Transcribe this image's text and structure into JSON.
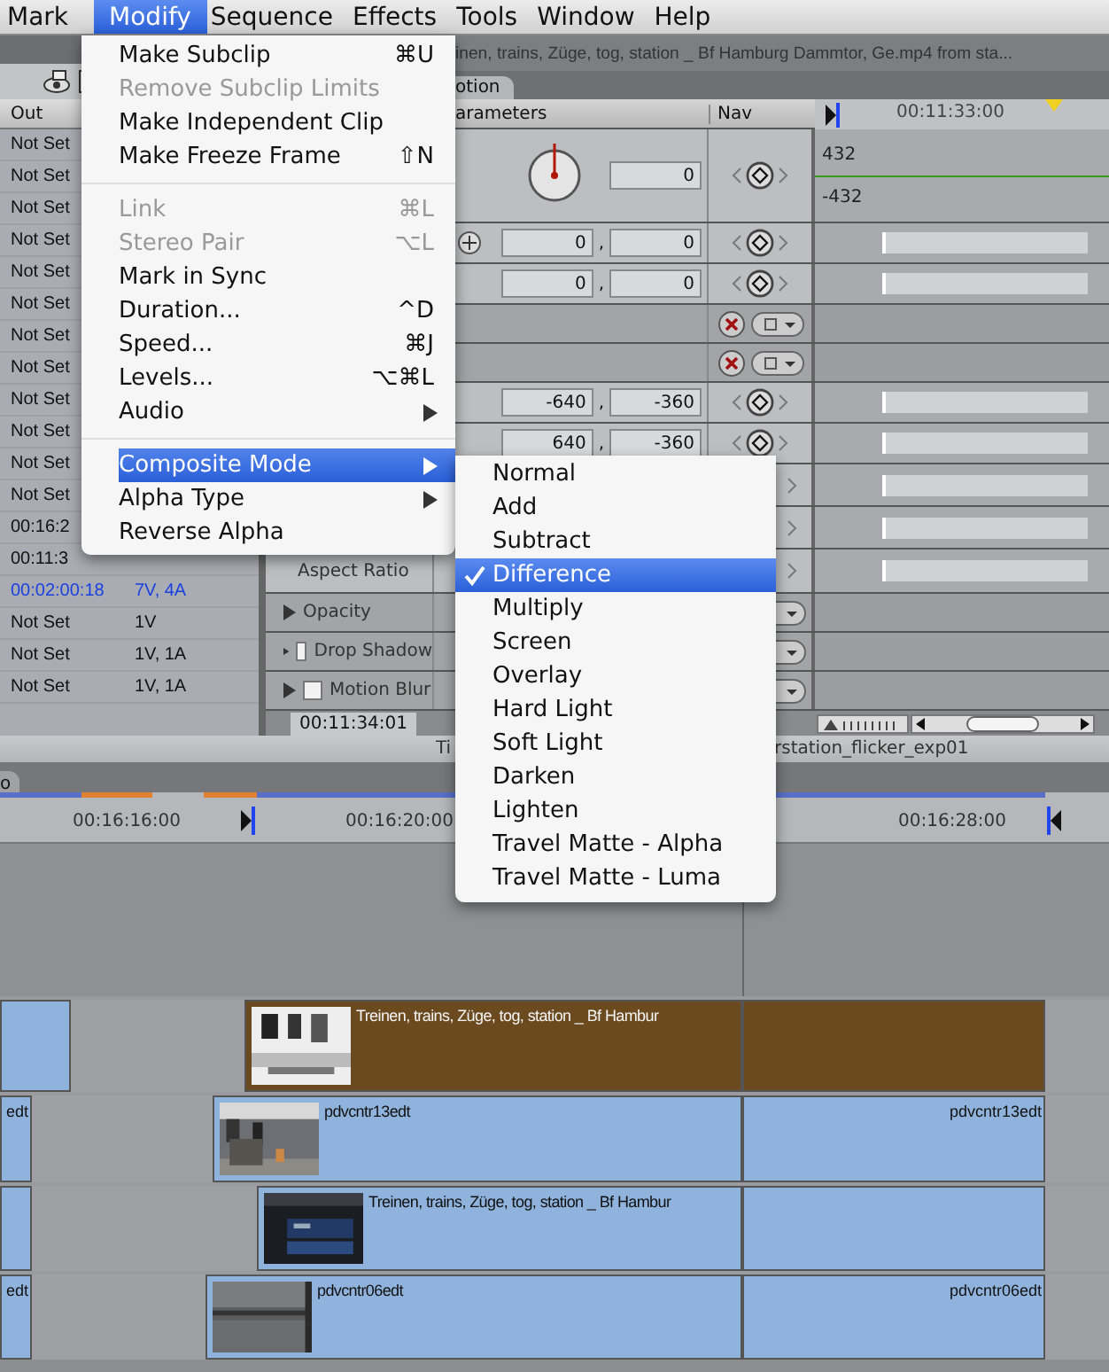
{
  "menu_bar": [
    {
      "label": "Mark",
      "selected": false
    },
    {
      "label": "Modify",
      "selected": true
    },
    {
      "label": "Sequence",
      "selected": false
    },
    {
      "label": "Effects",
      "selected": false
    },
    {
      "label": "Tools",
      "selected": false
    },
    {
      "label": "Window",
      "selected": false
    },
    {
      "label": "Help",
      "selected": false
    }
  ],
  "modify_menu": [
    {
      "label": "Make Subclip",
      "shortcut": "⌘U",
      "disabled": false,
      "selected": false,
      "submenu": false,
      "separator_before": false
    },
    {
      "label": "Remove Subclip Limits",
      "disabled": true,
      "selected": false,
      "submenu": false,
      "separator_before": false
    },
    {
      "label": "Make Independent Clip",
      "disabled": false,
      "selected": false,
      "submenu": false,
      "separator_before": false
    },
    {
      "label": "Make Freeze Frame",
      "shortcut": "⇧N",
      "disabled": false,
      "selected": false,
      "submenu": false,
      "separator_before": false
    },
    {
      "label": "Link",
      "shortcut": "⌘L",
      "disabled": true,
      "selected": false,
      "submenu": false,
      "separator_before": true
    },
    {
      "label": "Stereo Pair",
      "shortcut": "⌥L",
      "disabled": true,
      "selected": false,
      "submenu": false,
      "separator_before": false
    },
    {
      "label": "Mark in Sync",
      "disabled": false,
      "selected": false,
      "submenu": false,
      "separator_before": false
    },
    {
      "label": "Duration...",
      "shortcut": "^D",
      "disabled": false,
      "selected": false,
      "submenu": false,
      "separator_before": false
    },
    {
      "label": "Speed...",
      "shortcut": "⌘J",
      "disabled": false,
      "selected": false,
      "submenu": false,
      "separator_before": false
    },
    {
      "label": "Levels...",
      "shortcut": "⌥⌘L",
      "disabled": false,
      "selected": false,
      "submenu": false,
      "separator_before": false
    },
    {
      "label": "Audio",
      "disabled": false,
      "selected": false,
      "submenu": true,
      "separator_before": false
    },
    {
      "label": "Composite Mode",
      "disabled": false,
      "selected": true,
      "submenu": true,
      "separator_before": true
    },
    {
      "label": "Alpha Type",
      "disabled": false,
      "selected": false,
      "submenu": true,
      "separator_before": false
    },
    {
      "label": "Reverse Alpha",
      "disabled": false,
      "selected": false,
      "submenu": false,
      "separator_before": false
    }
  ],
  "composite_submenu": [
    {
      "label": "Normal",
      "checked": false,
      "selected": false
    },
    {
      "label": "Add",
      "checked": false,
      "selected": false
    },
    {
      "label": "Subtract",
      "checked": false,
      "selected": false
    },
    {
      "label": "Difference",
      "checked": true,
      "selected": true
    },
    {
      "label": "Multiply",
      "checked": false,
      "selected": false
    },
    {
      "label": "Screen",
      "checked": false,
      "selected": false
    },
    {
      "label": "Overlay",
      "checked": false,
      "selected": false
    },
    {
      "label": "Hard Light",
      "checked": false,
      "selected": false
    },
    {
      "label": "Soft Light",
      "checked": false,
      "selected": false
    },
    {
      "label": "Darken",
      "checked": false,
      "selected": false
    },
    {
      "label": "Lighten",
      "checked": false,
      "selected": false
    },
    {
      "label": "Travel Matte - Alpha",
      "checked": false,
      "selected": false
    },
    {
      "label": "Travel Matte - Luma",
      "checked": false,
      "selected": false
    }
  ],
  "browser": {
    "header": "Out",
    "rows": [
      {
        "out": "Not Set",
        "highlighted": false
      },
      {
        "out": "Not Set",
        "highlighted": false
      },
      {
        "out": "Not Set",
        "highlighted": false
      },
      {
        "out": "Not Set",
        "highlighted": false
      },
      {
        "out": "Not Set",
        "highlighted": false
      },
      {
        "out": "Not Set",
        "highlighted": false
      },
      {
        "out": "Not Set",
        "highlighted": false
      },
      {
        "out": "Not Set",
        "highlighted": false
      },
      {
        "out": "Not Set",
        "highlighted": false
      },
      {
        "out": "Not Set",
        "highlighted": false
      },
      {
        "out": "Not Set",
        "highlighted": false
      },
      {
        "out": "Not Set",
        "highlighted": false
      },
      {
        "out": "00:16:2",
        "highlighted": false
      },
      {
        "out": "00:11:3",
        "highlighted": false
      },
      {
        "out": "00:02:00:18",
        "tracks": "7V, 4A",
        "highlighted": true
      },
      {
        "out": "Not Set",
        "tracks": "1V",
        "highlighted": false
      },
      {
        "out": "Not Set",
        "tracks": "1V, 1A",
        "highlighted": false
      },
      {
        "out": "Not Set",
        "tracks": "1V, 1A",
        "highlighted": false
      }
    ]
  },
  "viewer": {
    "title": "inen, trains, Züge, tog, station _ Bf Hamburg Dammtor, Ge.mp4 from sta...",
    "tab": "otion",
    "headers": [
      "arameters",
      "Nav"
    ],
    "rows": [
      {
        "kind": "dial",
        "value": "0"
      },
      {
        "kind": "pair",
        "values": [
          "0",
          "0"
        ],
        "separator": ",",
        "crosshair": true
      },
      {
        "kind": "pair",
        "values": [
          "0",
          "0"
        ],
        "separator": ","
      },
      {
        "kind": "section"
      },
      {
        "kind": "section"
      },
      {
        "kind": "pair",
        "values": [
          "-640",
          "-360"
        ],
        "separator": ","
      },
      {
        "kind": "pair",
        "values": [
          "640",
          "-360"
        ],
        "separator": ","
      },
      {
        "kind": "nav_only"
      },
      {
        "kind": "nav_only"
      },
      {
        "kind": "param",
        "label": "Aspect Ratio"
      },
      {
        "kind": "group",
        "label": "Opacity"
      },
      {
        "kind": "group",
        "label": "Drop Shadow",
        "checked": false
      },
      {
        "kind": "group",
        "label": "Motion Blur",
        "checked": false
      }
    ],
    "timecode": "00:11:34:01"
  },
  "graph": {
    "timecode": "00:11:33:00",
    "values": [
      "432",
      "-432"
    ],
    "zoom_slider": {
      "level": 0.05
    }
  },
  "timeline": {
    "title_left": "Ti",
    "title_right": "rstation_flicker_exp01",
    "tab": "o",
    "ruler": [
      "00:16:16:00",
      "00:16:20:00",
      "00:16:28:00"
    ],
    "tracks": [
      {
        "clips": [
          {
            "color": "#8fb3dc",
            "thumbnail": false
          },
          {
            "color": "#6b4a1f",
            "thumbnail": true,
            "label": "Treinen, trains, Züge, tog, station _ Bf Hambur"
          },
          {
            "color": "#6b4a1f",
            "thumbnail": false
          }
        ]
      },
      {
        "clips": [
          {
            "color": "#8fb3dc",
            "thumbnail": false,
            "label": "edt"
          },
          {
            "color": "#8fb3dc",
            "thumbnail": true,
            "label": "pdvcntr13edt"
          },
          {
            "color": "#8fb3dc",
            "thumbnail": false,
            "label": "pdvcntr13edt"
          }
        ]
      },
      {
        "clips": [
          {
            "color": "#8fb3dc",
            "thumbnail": false
          },
          {
            "color": "#8fb3dc",
            "thumbnail": true,
            "label": "Treinen, trains, Züge, tog, station _ Bf Hambur"
          },
          {
            "color": "#8fb3dc",
            "thumbnail": false
          }
        ]
      },
      {
        "clips": [
          {
            "color": "#8fb3dc",
            "thumbnail": false,
            "label": "edt"
          },
          {
            "color": "#8fb3dc",
            "thumbnail": true,
            "label": "pdvcntr06edt"
          },
          {
            "color": "#8fb3dc",
            "thumbnail": false,
            "label": "pdvcntr06edt"
          }
        ]
      }
    ]
  }
}
